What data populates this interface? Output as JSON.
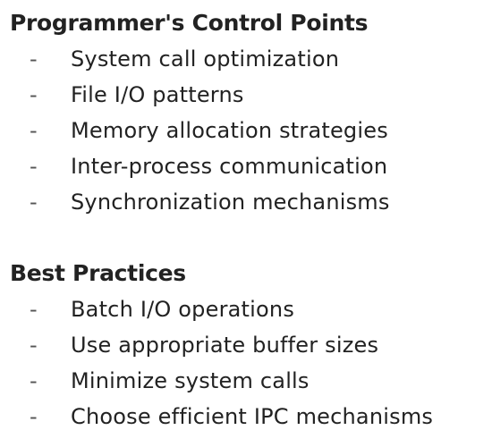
{
  "sections": [
    {
      "heading": "Programmer's Control Points",
      "items": [
        {
          "bullet": "-",
          "text": "System call optimization"
        },
        {
          "bullet": "-",
          "text": "File I/O patterns"
        },
        {
          "bullet": "-",
          "text": "Memory allocation strategies"
        },
        {
          "bullet": "-",
          "text": "Inter-process communication"
        },
        {
          "bullet": "-",
          "text": "Synchronization mechanisms"
        }
      ]
    },
    {
      "heading": "Best Practices",
      "items": [
        {
          "bullet": "-",
          "text": "Batch I/O operations"
        },
        {
          "bullet": "-",
          "text": "Use appropriate buffer sizes"
        },
        {
          "bullet": "-",
          "text": "Minimize system calls"
        },
        {
          "bullet": "-",
          "text": "Choose efficient IPC mechanisms"
        }
      ]
    }
  ]
}
